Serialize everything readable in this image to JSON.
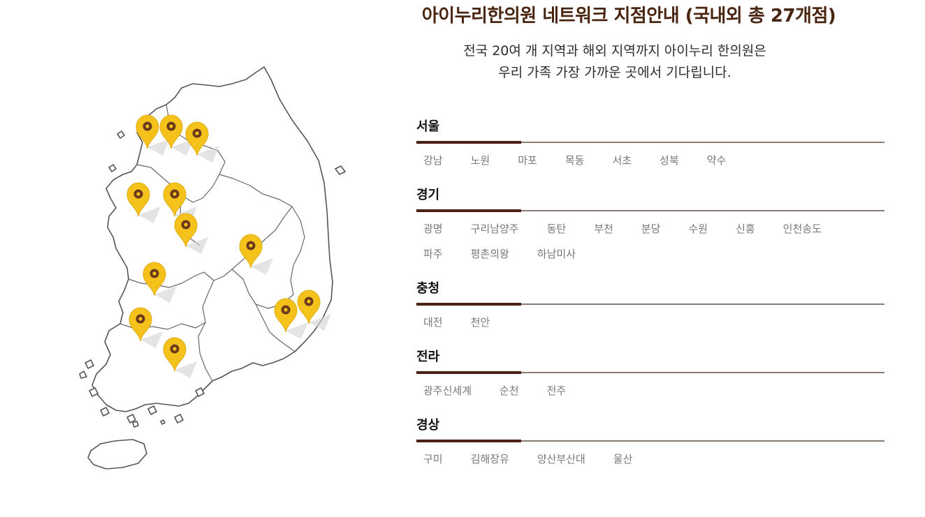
{
  "header": {
    "title": "아이누리한의원 네트워크 지점안내 (국내외 총 27개점)",
    "subtitle_line1": "전국 20여 개 지역과 해외 지역까지 아이누리 한의원은",
    "subtitle_line2": "우리 가족 가장 가까운 곳에서 기다립니다."
  },
  "colors": {
    "title": "#4a2612",
    "pin_fill": "#f5c21b",
    "pin_dot": "#6b3a1c",
    "region_accent": "#4a1f14",
    "region_line": "#8c7a74",
    "branch_text": "#777777"
  },
  "map": {
    "icon": "korea-map",
    "pin_icon": "map-pin-icon",
    "pin_count": 13
  },
  "regions": [
    {
      "name": "서울",
      "branches": [
        "강남",
        "노원",
        "마포",
        "목동",
        "서초",
        "성북",
        "약수"
      ]
    },
    {
      "name": "경기",
      "branches": [
        "광명",
        "구리남양주",
        "동탄",
        "부천",
        "분당",
        "수원",
        "신흥",
        "인천송도",
        "파주",
        "평촌의왕",
        "하남미사"
      ]
    },
    {
      "name": "충청",
      "branches": [
        "대전",
        "천안"
      ]
    },
    {
      "name": "전라",
      "branches": [
        "광주신세계",
        "순천",
        "전주"
      ]
    },
    {
      "name": "경상",
      "branches": [
        "구미",
        "김해장유",
        "양산부산대",
        "울산"
      ]
    }
  ]
}
